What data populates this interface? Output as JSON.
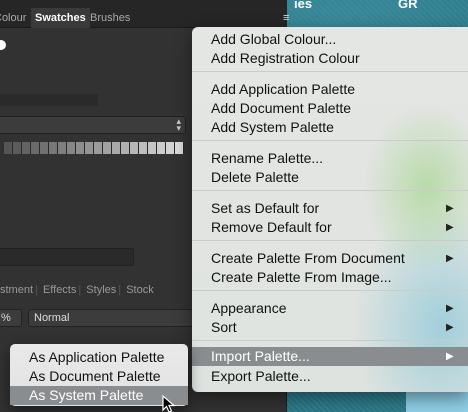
{
  "background": {
    "partial_text_left": "ies",
    "partial_text_right": "GR"
  },
  "panel": {
    "tabs": [
      {
        "label": "Colour"
      },
      {
        "label": "Swatches"
      },
      {
        "label": "Brushes"
      }
    ],
    "menu_icon": "≡",
    "sub_tabs": [
      "stment",
      "Effects",
      "Styles",
      "Stock"
    ],
    "opacity_value": "%",
    "blend_mode": "Normal",
    "swatch_greys": [
      "#555555",
      "#5c5c5c",
      "#636363",
      "#6a6a6a",
      "#717171",
      "#787878",
      "#7f7f7f",
      "#868686",
      "#8d8d8d",
      "#949494",
      "#9b9b9b",
      "#a2a2a2",
      "#a9a9a9",
      "#b0b0b0",
      "#b7b7b7",
      "#bebebe",
      "#c5c5c5",
      "#cccccc",
      "#d3d3d3",
      "#dadada"
    ]
  },
  "menu": {
    "items": [
      {
        "label": "Add Global Colour..."
      },
      {
        "label": "Add Registration Colour"
      },
      {
        "label": "Add Application Palette"
      },
      {
        "label": "Add Document Palette"
      },
      {
        "label": "Add System Palette"
      },
      {
        "label": "Rename Palette..."
      },
      {
        "label": "Delete Palette"
      },
      {
        "label": "Set as Default for",
        "submenu": true
      },
      {
        "label": "Remove Default for",
        "submenu": true
      },
      {
        "label": "Create Palette From Document",
        "submenu": true
      },
      {
        "label": "Create Palette From Image..."
      },
      {
        "label": "Appearance",
        "submenu": true
      },
      {
        "label": "Sort",
        "submenu": true
      },
      {
        "label": "Import Palette...",
        "submenu": true,
        "highlighted": true
      },
      {
        "label": "Export Palette..."
      }
    ],
    "arrow_glyph": "▶"
  },
  "submenu": {
    "items": [
      {
        "label": "As Application Palette"
      },
      {
        "label": "As Document Palette"
      },
      {
        "label": "As System Palette",
        "highlighted": true
      }
    ]
  },
  "colors": {
    "highlight": "#8a8d90",
    "panel_bg": "#323232",
    "menu_bg": "#e2e4e2"
  }
}
